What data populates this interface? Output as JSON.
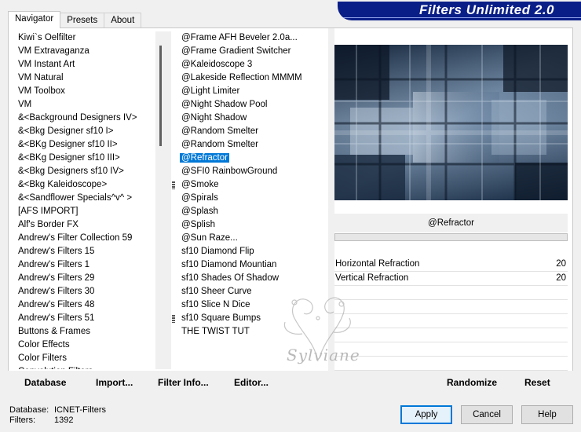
{
  "tabs": [
    "Navigator",
    "Presets",
    "About"
  ],
  "banner_title": "Filters Unlimited 2.0",
  "categories": [
    "Kiwi`s Oelfilter",
    "VM Extravaganza",
    "VM Instant Art",
    "VM Natural",
    "VM Toolbox",
    "VM",
    "&<Background Designers IV>",
    "&<Bkg Designer sf10 I>",
    "&<BKg Designer sf10 II>",
    "&<BKg Designer sf10 III>",
    "&<Bkg Designers sf10 IV>",
    "&<Bkg Kaleidoscope>",
    "&<Sandflower Specials^v^ >",
    "[AFS IMPORT]",
    "Alf's Border FX",
    "Andrew's Filter Collection 59",
    "Andrew's Filters 15",
    "Andrew's Filters 1",
    "Andrew's Filters 29",
    "Andrew's Filters 30",
    "Andrew's Filters 48",
    "Andrew's Filters 51",
    "Buttons & Frames",
    "Color Effects",
    "Color Filters",
    "Convolution Filters"
  ],
  "filters": [
    "@Frame AFH Beveler 2.0a...",
    "@Frame Gradient Switcher",
    "@Kaleidoscope 3",
    "@Lakeside Reflection MMMM",
    "@Light Limiter",
    "@Night Shadow Pool",
    "@Night Shadow",
    "@Random Smelter",
    "@Random Smelter",
    "@Refractor",
    "@SFI0 RainbowGround",
    "@Smoke",
    "@Spirals",
    "@Splash",
    "@Splish",
    "@Sun Raze...",
    "sf10 Diamond Flip",
    "sf10 Diamond Mountian",
    "sf10 Shades Of Shadow",
    "sf10 Sheer Curve",
    "sf10 Slice N Dice",
    "sf10 Square Bumps",
    "THE TWIST TUT"
  ],
  "selected_filter_index": 9,
  "filter_name": "@Refractor",
  "params": [
    {
      "label": "Horizontal Refraction",
      "value": "20"
    },
    {
      "label": "Vertical Refraction",
      "value": "20"
    }
  ],
  "toolbar": {
    "database": "Database",
    "import": "Import...",
    "filter_info": "Filter Info...",
    "editor": "Editor...",
    "randomize": "Randomize",
    "reset": "Reset"
  },
  "status": {
    "database_label": "Database:",
    "database_value": "ICNET-Filters",
    "filters_label": "Filters:",
    "filters_value": "1392"
  },
  "buttons": {
    "apply": "Apply",
    "cancel": "Cancel",
    "help": "Help"
  },
  "watermark_text": "Sylviane"
}
